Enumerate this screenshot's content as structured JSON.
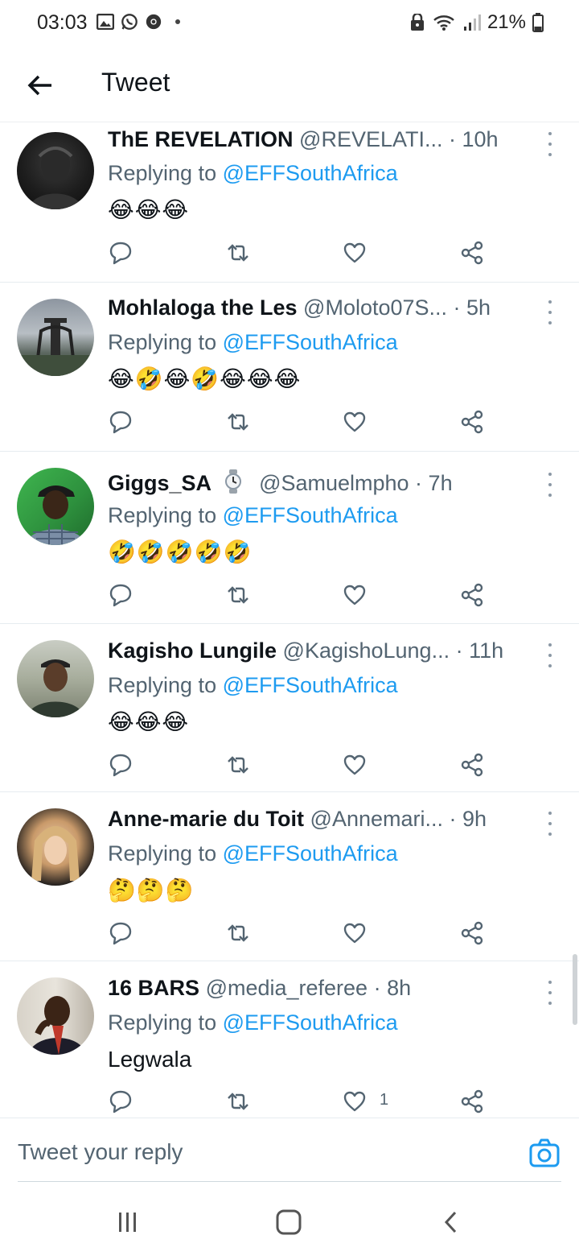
{
  "status_bar": {
    "time": "03:03",
    "battery": "21%",
    "left_icons": [
      "image-icon",
      "whatsapp-icon",
      "chrome-icon"
    ],
    "right_icons": [
      "lock-icon",
      "wifi-icon",
      "signal-icon",
      "battery-icon"
    ]
  },
  "header": {
    "title": "Tweet",
    "back_icon": "arrow-left-icon"
  },
  "replying_prefix": "Replying to",
  "replying_handle": "@EFFSouthAfrica",
  "tweets": [
    {
      "name": "ThE REVELATION",
      "handle_time": "@REVELATI... · 10h",
      "body": "😂😂😂",
      "likes": ""
    },
    {
      "name": "Mohlaloga the Les",
      "handle_time": "@Moloto07S... · 5h",
      "body": "😂🤣😂🤣😂😂😂",
      "likes": ""
    },
    {
      "name": "Giggs_SA",
      "name_icon": "watch-icon",
      "handle_time": "@Samuelmpho · 7h",
      "body": "🤣🤣🤣🤣🤣",
      "likes": ""
    },
    {
      "name": "Kagisho Lungile",
      "handle_time": "@KagishoLung... · 11h",
      "body": "😂😂😂",
      "likes": ""
    },
    {
      "name": "Anne-marie du Toit",
      "handle_time": "@Annemari... · 9h",
      "body": "🤔🤔🤔",
      "likes": ""
    },
    {
      "name": "16 BARS",
      "handle_time": "@media_referee · 8h",
      "body": "Legwala",
      "likes": "1"
    }
  ],
  "action_icons": [
    "reply-icon",
    "retweet-icon",
    "like-icon",
    "share-icon"
  ],
  "reply_box": {
    "placeholder": "Tweet your reply",
    "camera_icon": "camera-icon",
    "accent": "#1d9bf0"
  },
  "nav_bar": [
    "recent-apps-icon",
    "home-icon",
    "back-icon"
  ]
}
